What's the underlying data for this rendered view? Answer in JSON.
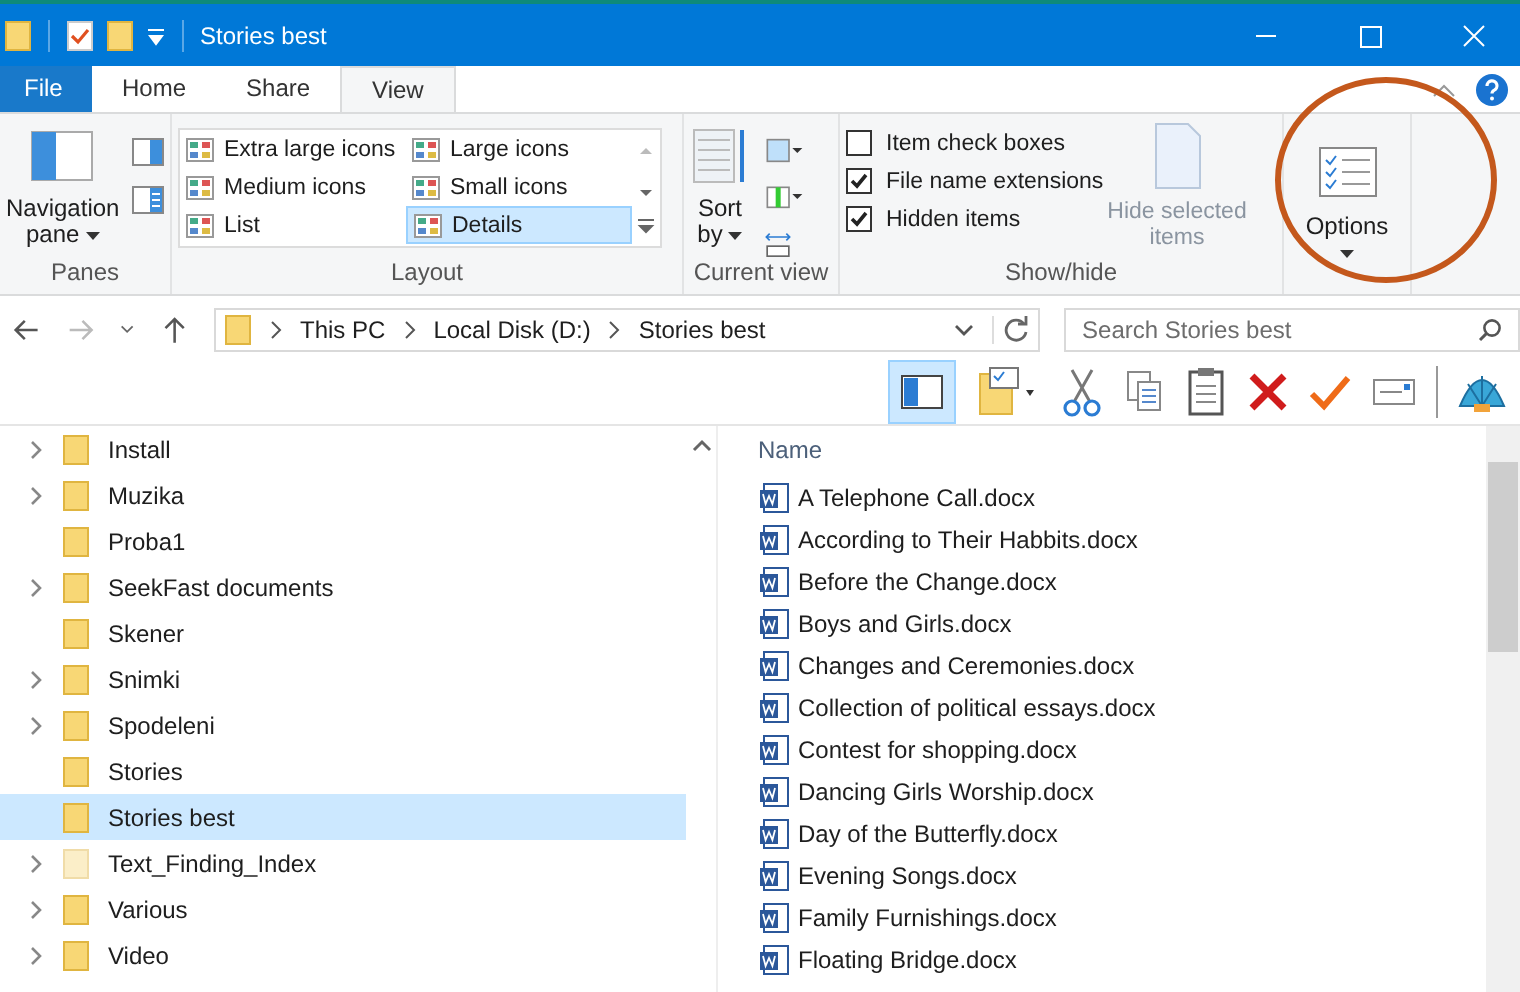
{
  "window": {
    "title": "Stories best"
  },
  "tabs": [
    {
      "label": "File",
      "selected": false,
      "kind": "file"
    },
    {
      "label": "Home",
      "selected": false,
      "kind": "tab"
    },
    {
      "label": "Share",
      "selected": false,
      "kind": "tab"
    },
    {
      "label": "View",
      "selected": true,
      "kind": "tab"
    }
  ],
  "ribbon": {
    "panes": {
      "navigation_pane": [
        "Navigation",
        "pane"
      ],
      "label": "Panes"
    },
    "layout": {
      "items": [
        {
          "label": "Extra large icons",
          "selected": false
        },
        {
          "label": "Large icons",
          "selected": false
        },
        {
          "label": "Medium icons",
          "selected": false
        },
        {
          "label": "Small icons",
          "selected": false
        },
        {
          "label": "List",
          "selected": false
        },
        {
          "label": "Details",
          "selected": true
        }
      ],
      "label": "Layout"
    },
    "current_view": {
      "sort_by": [
        "Sort",
        "by"
      ],
      "label": "Current view"
    },
    "show_hide": {
      "checkboxes": [
        {
          "label": "Item check boxes",
          "checked": false
        },
        {
          "label": "File name extensions",
          "checked": true
        },
        {
          "label": "Hidden items",
          "checked": true
        }
      ],
      "hide_selected": {
        "label": [
          "Hide selected",
          "items"
        ],
        "disabled": true
      },
      "label": "Show/hide"
    },
    "options": {
      "label": "Options"
    }
  },
  "address": {
    "path": [
      "This PC",
      "Local Disk (D:)",
      "Stories best"
    ],
    "search_placeholder": "Search Stories best"
  },
  "tree": [
    {
      "label": "Install",
      "expandable": true,
      "selected": false,
      "hidden": false
    },
    {
      "label": "Muzika",
      "expandable": true,
      "selected": false,
      "hidden": false
    },
    {
      "label": "Proba1",
      "expandable": false,
      "selected": false,
      "hidden": false
    },
    {
      "label": "SeekFast documents",
      "expandable": true,
      "selected": false,
      "hidden": false
    },
    {
      "label": "Skener",
      "expandable": false,
      "selected": false,
      "hidden": false
    },
    {
      "label": "Snimki",
      "expandable": true,
      "selected": false,
      "hidden": false
    },
    {
      "label": "Spodeleni",
      "expandable": true,
      "selected": false,
      "hidden": false
    },
    {
      "label": "Stories",
      "expandable": false,
      "selected": false,
      "hidden": false
    },
    {
      "label": "Stories best",
      "expandable": false,
      "selected": true,
      "hidden": false
    },
    {
      "label": "Text_Finding_Index",
      "expandable": true,
      "selected": false,
      "hidden": true
    },
    {
      "label": "Various",
      "expandable": true,
      "selected": false,
      "hidden": false
    },
    {
      "label": "Video",
      "expandable": true,
      "selected": false,
      "hidden": false
    }
  ],
  "files": {
    "column": "Name",
    "items": [
      "A Telephone Call.docx",
      "According to Their Habbits.docx",
      "Before the Change.docx",
      "Boys and Girls.docx",
      "Changes and Ceremonies.docx",
      "Collection of political essays.docx",
      "Contest for shopping.docx",
      "Dancing Girls Worship.docx",
      "Day of the Butterfly.docx",
      "Evening Songs.docx",
      "Family Furnishings.docx",
      "Floating Bridge.docx"
    ]
  }
}
